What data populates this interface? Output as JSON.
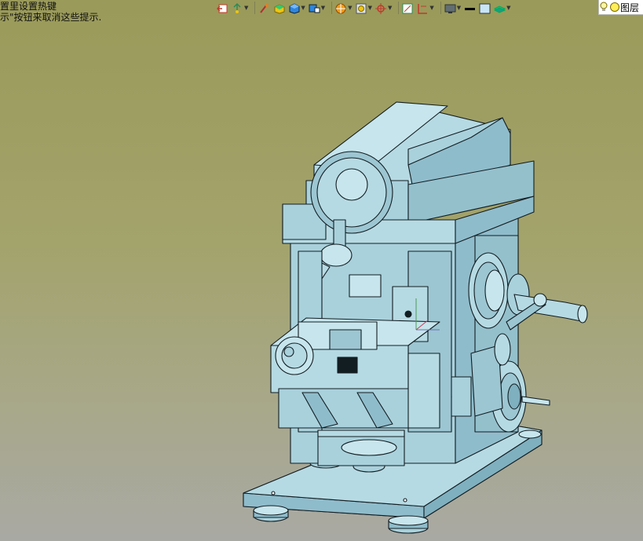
{
  "hints": {
    "line1": "置里设置热键",
    "line2": "示\"按钮来取消这些提示."
  },
  "toolbar": {
    "items": [
      {
        "name": "exit-sketch-icon",
        "has_dropdown": false
      },
      {
        "name": "smart-dimension-icon",
        "has_dropdown": true
      },
      {
        "name": "paint-brush-icon",
        "has_dropdown": false
      },
      {
        "name": "solid-box-icon",
        "has_dropdown": false
      },
      {
        "name": "shaded-cube-icon",
        "has_dropdown": true
      },
      {
        "name": "view-orientation-icon",
        "has_dropdown": true
      },
      {
        "name": "section-view-icon",
        "has_dropdown": true
      },
      {
        "name": "zoom-to-fit-icon",
        "has_dropdown": true
      },
      {
        "name": "rotate-view-icon",
        "has_dropdown": true
      },
      {
        "name": "sketch-plane-icon",
        "has_dropdown": false
      },
      {
        "name": "dimension-display-icon",
        "has_dropdown": true
      },
      {
        "name": "display-monitor-icon",
        "has_dropdown": true
      },
      {
        "name": "line-style-icon",
        "has_dropdown": false
      },
      {
        "name": "background-color-icon",
        "has_dropdown": false
      },
      {
        "name": "layer-icon",
        "has_dropdown": true
      }
    ]
  },
  "layer_panel": {
    "label": "图层"
  },
  "model": {
    "name": "CAD machine assembly"
  },
  "colors": {
    "part_fill": "#a9d1dc",
    "part_light": "#c7e5ec",
    "part_dark": "#7fb0bf",
    "edge": "#121d22",
    "background_top": "#9a9a5a",
    "background_bottom": "#a9a9a4"
  }
}
